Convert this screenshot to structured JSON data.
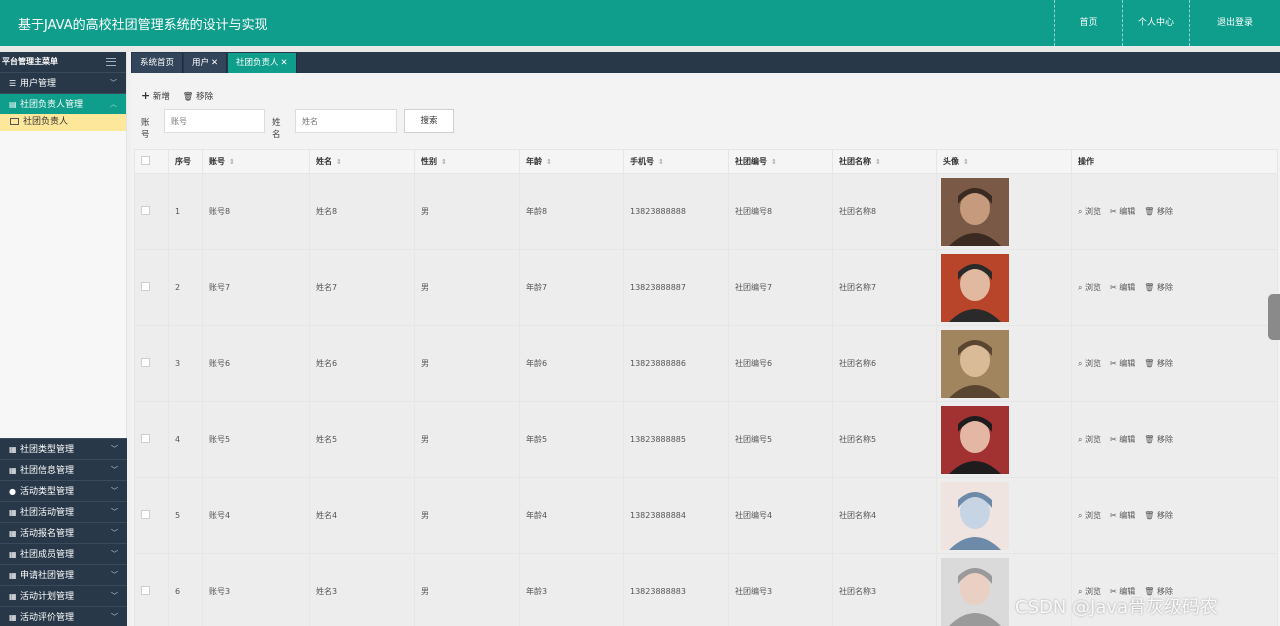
{
  "header": {
    "title": "基于JAVA的高校社团管理系统的设计与实现",
    "nav": [
      "首页",
      "个人中心",
      "退出登录"
    ]
  },
  "sidebar": {
    "title": "平台管理主菜单",
    "groups_top": [
      {
        "label": "用户管理",
        "icon": "sliders-icon",
        "active": false
      },
      {
        "label": "社团负责人管理",
        "icon": "doc-icon",
        "active": true
      }
    ],
    "submenu": "社团负责人",
    "groups_bottom": [
      {
        "label": "社团类型管理",
        "icon": "grid-icon"
      },
      {
        "label": "社团信息管理",
        "icon": "grid-icon"
      },
      {
        "label": "活动类型管理",
        "icon": "user-icon"
      },
      {
        "label": "社团活动管理",
        "icon": "grid-icon"
      },
      {
        "label": "活动报名管理",
        "icon": "grid-icon"
      },
      {
        "label": "社团成员管理",
        "icon": "grid-icon"
      },
      {
        "label": "申请社团管理",
        "icon": "grid-icon"
      },
      {
        "label": "活动计划管理",
        "icon": "grid-icon"
      },
      {
        "label": "活动评价管理",
        "icon": "grid-icon"
      }
    ]
  },
  "tabs": [
    "系统首页",
    "用户",
    "社团负责人"
  ],
  "toolbar": {
    "add": "新增",
    "remove": "移除"
  },
  "search": {
    "account_label": "账号",
    "account_placeholder": "账号",
    "name_label": "姓名",
    "name_placeholder": "姓名",
    "button": "搜索"
  },
  "table": {
    "columns": [
      "序号",
      "账号",
      "姓名",
      "性别",
      "年龄",
      "手机号",
      "社团编号",
      "社团名称",
      "头像",
      "操作"
    ],
    "rows": [
      {
        "no": "1",
        "account": "账号8",
        "name": "姓名8",
        "gender": "男",
        "age": "年龄8",
        "phone": "13823888888",
        "club_no": "社团编号8",
        "club_name": "社团名称8"
      },
      {
        "no": "2",
        "account": "账号7",
        "name": "姓名7",
        "gender": "男",
        "age": "年龄7",
        "phone": "13823888887",
        "club_no": "社团编号7",
        "club_name": "社团名称7"
      },
      {
        "no": "3",
        "account": "账号6",
        "name": "姓名6",
        "gender": "男",
        "age": "年龄6",
        "phone": "13823888886",
        "club_no": "社团编号6",
        "club_name": "社团名称6"
      },
      {
        "no": "4",
        "account": "账号5",
        "name": "姓名5",
        "gender": "男",
        "age": "年龄5",
        "phone": "13823888885",
        "club_no": "社团编号5",
        "club_name": "社团名称5"
      },
      {
        "no": "5",
        "account": "账号4",
        "name": "姓名4",
        "gender": "男",
        "age": "年龄4",
        "phone": "13823888884",
        "club_no": "社团编号4",
        "club_name": "社团名称4"
      },
      {
        "no": "6",
        "account": "账号3",
        "name": "姓名3",
        "gender": "男",
        "age": "年龄3",
        "phone": "13823888883",
        "club_no": "社团编号3",
        "club_name": "社团名称3"
      }
    ],
    "ops": [
      "浏览",
      "编辑",
      "移除"
    ]
  },
  "watermark": "CSDN @Java骨灰级码农",
  "colors": {
    "accent": "#0f9e8c",
    "sidebar_dark": "#283848",
    "submenu_highlight": "#fde79a"
  }
}
